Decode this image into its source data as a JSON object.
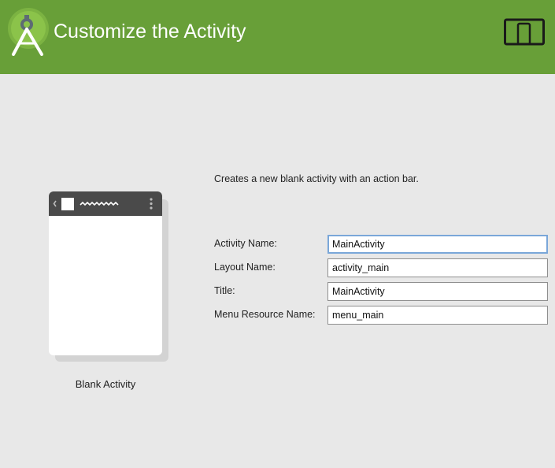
{
  "header": {
    "title": "Customize the Activity",
    "background_color": "#689f38",
    "logo_icon": "android-studio-icon",
    "device_icon": "phone-tablet-icon"
  },
  "template": {
    "name": "Blank Activity",
    "description": "Creates a new blank activity with an action bar."
  },
  "form": {
    "fields": [
      {
        "label": "Activity Name:",
        "value": "MainActivity",
        "focused": true
      },
      {
        "label": "Layout Name:",
        "value": "activity_main",
        "focused": false
      },
      {
        "label": "Title:",
        "value": "MainActivity",
        "focused": false
      },
      {
        "label": "Menu Resource Name:",
        "value": "menu_main",
        "focused": false
      }
    ]
  }
}
